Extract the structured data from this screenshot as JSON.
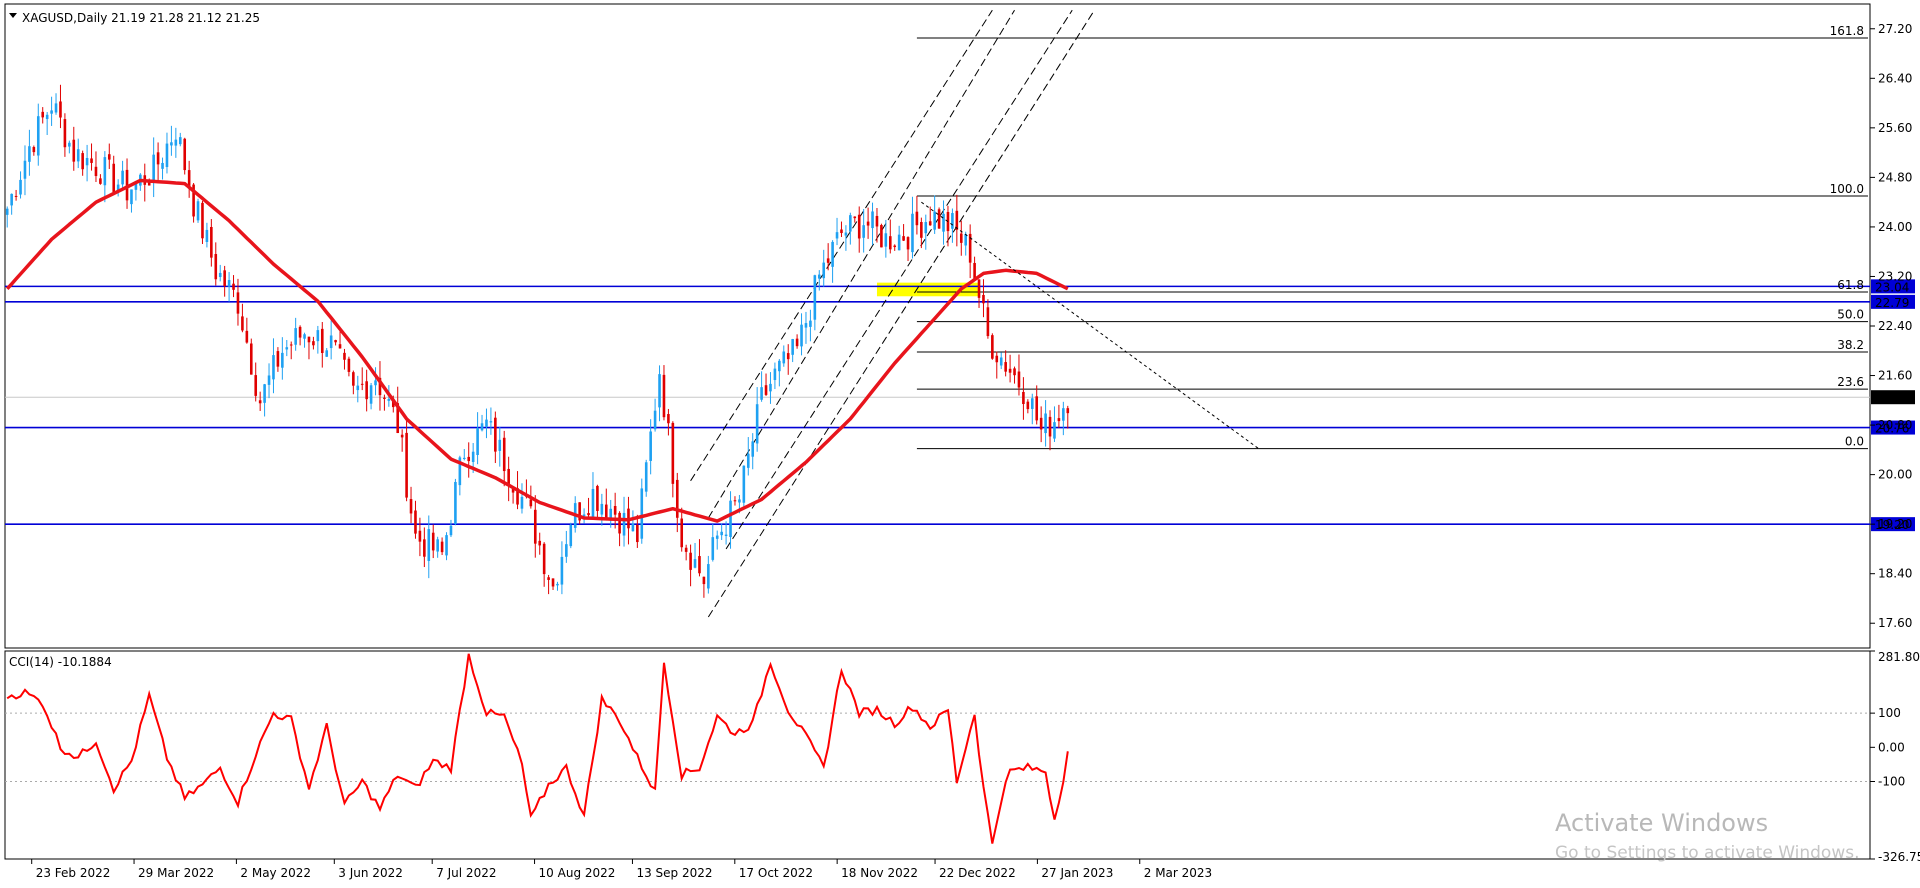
{
  "window": {
    "symbol_header": "XAGUSD,Daily  21.19 21.28 21.12 21.25",
    "watermark_title": "Activate Windows",
    "watermark_sub": "Go to Settings to activate Windows."
  },
  "colors": {
    "candle_up": "#1ea1f2",
    "candle_down": "#e00000",
    "ma": "#e8141c",
    "hline": "#0000d6",
    "zone": "#ffff00",
    "cci": "#ff0000",
    "fib": "#000000"
  },
  "chart_data": [
    {
      "type": "line",
      "panel": "price",
      "ylim": [
        17.2,
        27.6
      ],
      "y_ticks": [
        "27.20",
        "26.40",
        "25.60",
        "24.80",
        "24.00",
        "23.20",
        "22.40",
        "21.60",
        "20.80",
        "20.00",
        "19.20",
        "18.40",
        "17.60"
      ],
      "x_labels": [
        "23 Feb 2022",
        "29 Mar 2022",
        "2 May 2022",
        "3 Jun 2022",
        "7 Jul 2022",
        "10 Aug 2022",
        "13 Sep 2022",
        "17 Oct 2022",
        "18 Nov 2022",
        "22 Dec 2022",
        "27 Jan 2023",
        "2 Mar 2023"
      ],
      "price_series_knots": [
        [
          0,
          24.3
        ],
        [
          5,
          25.3
        ],
        [
          10,
          26.0
        ],
        [
          15,
          25.2
        ],
        [
          20,
          25.0
        ],
        [
          27,
          24.6
        ],
        [
          33,
          24.9
        ],
        [
          38,
          25.6
        ],
        [
          42,
          24.4
        ],
        [
          47,
          23.3
        ],
        [
          52,
          22.8
        ],
        [
          57,
          21.2
        ],
        [
          62,
          22.0
        ],
        [
          67,
          22.3
        ],
        [
          73,
          22.1
        ],
        [
          78,
          21.3
        ],
        [
          83,
          21.6
        ],
        [
          88,
          20.8
        ],
        [
          92,
          19.0
        ],
        [
          98,
          18.7
        ],
        [
          103,
          20.4
        ],
        [
          108,
          20.8
        ],
        [
          113,
          20.1
        ],
        [
          118,
          19.3
        ],
        [
          123,
          18.2
        ],
        [
          127,
          19.3
        ],
        [
          132,
          19.7
        ],
        [
          137,
          19.4
        ],
        [
          142,
          19.0
        ],
        [
          147,
          21.7
        ],
        [
          152,
          19.0
        ],
        [
          157,
          18.3
        ],
        [
          160,
          19.0
        ],
        [
          165,
          19.6
        ],
        [
          170,
          21.2
        ],
        [
          173,
          21.6
        ],
        [
          178,
          22.0
        ],
        [
          183,
          23.2
        ],
        [
          188,
          23.9
        ],
        [
          193,
          24.1
        ],
        [
          198,
          23.8
        ],
        [
          203,
          23.9
        ],
        [
          208,
          24.2
        ],
        [
          213,
          24.0
        ],
        [
          217,
          23.6
        ],
        [
          221,
          22.2
        ],
        [
          226,
          21.7
        ],
        [
          230,
          21.3
        ],
        [
          233,
          20.7
        ],
        [
          236,
          20.9
        ],
        [
          239,
          21.25
        ]
      ],
      "ma_series": [
        [
          0,
          23.0
        ],
        [
          10,
          23.8
        ],
        [
          20,
          24.4
        ],
        [
          30,
          24.75
        ],
        [
          40,
          24.7
        ],
        [
          50,
          24.1
        ],
        [
          60,
          23.4
        ],
        [
          70,
          22.8
        ],
        [
          80,
          21.9
        ],
        [
          90,
          20.9
        ],
        [
          100,
          20.25
        ],
        [
          110,
          19.95
        ],
        [
          120,
          19.55
        ],
        [
          130,
          19.3
        ],
        [
          140,
          19.27
        ],
        [
          150,
          19.45
        ],
        [
          160,
          19.25
        ],
        [
          170,
          19.6
        ],
        [
          180,
          20.2
        ],
        [
          190,
          20.9
        ],
        [
          200,
          21.8
        ],
        [
          210,
          22.6
        ],
        [
          215,
          23.0
        ],
        [
          220,
          23.25
        ],
        [
          225,
          23.3
        ],
        [
          232,
          23.25
        ],
        [
          239,
          23.0
        ]
      ],
      "horizontal_levels": [
        {
          "value": 23.04,
          "label": "23.04"
        },
        {
          "value": 22.79,
          "label": "22.79"
        },
        {
          "value": 20.76,
          "label": "20.76"
        },
        {
          "value": 19.2,
          "label": "19.20"
        }
      ],
      "current_price": {
        "value": 21.25,
        "label": "21.25"
      },
      "fibonacci": {
        "x_start": 205,
        "levels": [
          {
            "ratio": "161.8",
            "value": 27.05
          },
          {
            "ratio": "100.0",
            "value": 24.5
          },
          {
            "ratio": "61.8",
            "value": 22.95
          },
          {
            "ratio": "50.0",
            "value": 22.47
          },
          {
            "ratio": "38.2",
            "value": 21.98
          },
          {
            "ratio": "23.6",
            "value": 21.38
          },
          {
            "ratio": "0.0",
            "value": 20.42
          }
        ]
      },
      "yellow_zone": {
        "x_from": 196,
        "x_to": 219,
        "y_from": 22.88,
        "y_to": 23.1
      },
      "channel": {
        "inner": [
          [
            [
              154,
              19.9
            ],
            [
              222,
              27.5
            ]
          ],
          [
            [
              158,
              19.3
            ],
            [
              227,
              27.5
            ]
          ],
          [
            [
              162,
              18.8
            ],
            [
              240,
              27.5
            ]
          ],
          [
            [
              158,
              17.7
            ],
            [
              245,
              27.5
            ]
          ]
        ]
      },
      "trendline": [
        [
          206,
          24.4
        ],
        [
          282,
          20.42
        ]
      ]
    },
    {
      "type": "line",
      "panel": "cci",
      "title": "CCI(14) -10.1884",
      "ylim": [
        -326.754,
        281.803
      ],
      "y_ticks": [
        "281.803",
        "100",
        "0.00",
        "-100",
        "-326.754"
      ],
      "levels": [
        100,
        -100
      ],
      "series_knots": [
        [
          0,
          150
        ],
        [
          4,
          160
        ],
        [
          8,
          130
        ],
        [
          12,
          0
        ],
        [
          16,
          -30
        ],
        [
          20,
          20
        ],
        [
          24,
          -120
        ],
        [
          28,
          -40
        ],
        [
          32,
          150
        ],
        [
          36,
          -30
        ],
        [
          40,
          -150
        ],
        [
          44,
          -110
        ],
        [
          48,
          -60
        ],
        [
          52,
          -160
        ],
        [
          56,
          -20
        ],
        [
          60,
          100
        ],
        [
          64,
          80
        ],
        [
          68,
          -120
        ],
        [
          72,
          60
        ],
        [
          76,
          -170
        ],
        [
          80,
          -100
        ],
        [
          84,
          -180
        ],
        [
          88,
          -80
        ],
        [
          92,
          -120
        ],
        [
          96,
          -40
        ],
        [
          100,
          -60
        ],
        [
          104,
          270
        ],
        [
          108,
          100
        ],
        [
          112,
          90
        ],
        [
          116,
          -50
        ],
        [
          118,
          -210
        ],
        [
          122,
          -110
        ],
        [
          126,
          -60
        ],
        [
          130,
          -200
        ],
        [
          134,
          140
        ],
        [
          138,
          80
        ],
        [
          142,
          -30
        ],
        [
          146,
          -130
        ],
        [
          148,
          250
        ],
        [
          152,
          -80
        ],
        [
          156,
          -60
        ],
        [
          160,
          90
        ],
        [
          164,
          40
        ],
        [
          168,
          70
        ],
        [
          172,
          250
        ],
        [
          176,
          110
        ],
        [
          180,
          30
        ],
        [
          184,
          -60
        ],
        [
          188,
          230
        ],
        [
          192,
          100
        ],
        [
          196,
          110
        ],
        [
          200,
          70
        ],
        [
          204,
          120
        ],
        [
          208,
          60
        ],
        [
          212,
          110
        ],
        [
          214,
          -100
        ],
        [
          216,
          0
        ],
        [
          218,
          100
        ],
        [
          220,
          -120
        ],
        [
          222,
          -280
        ],
        [
          224,
          -150
        ],
        [
          226,
          -70
        ],
        [
          230,
          -60
        ],
        [
          234,
          -70
        ],
        [
          236,
          -210
        ],
        [
          238,
          -90
        ],
        [
          239,
          -10
        ]
      ]
    }
  ]
}
